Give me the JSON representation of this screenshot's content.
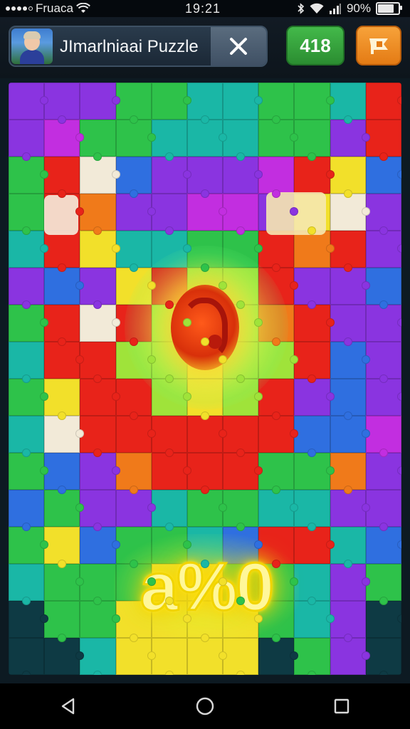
{
  "status_bar": {
    "carrier": "Fruaca",
    "time": "19:21",
    "battery": "90%",
    "battery_level": 0.9
  },
  "header": {
    "title": "JImarlniaai Puzzle",
    "score": "418",
    "close_icon": "close-icon",
    "flag_icon": "flag-icon"
  },
  "board": {
    "progress_label": "a%0",
    "center_icon": "question-orb-icon",
    "rows": 16,
    "cols": 11,
    "palette": {
      "R": "#e8231a",
      "O": "#f07a1a",
      "Y": "#f2e02a",
      "G": "#2ec24a",
      "T": "#1ab7a6",
      "B": "#2f6fe0",
      "P": "#8a34e0",
      "M": "#c22ee0",
      "D": "#0e3a44",
      "W": "#f2ead8",
      "L": "#9fe33a"
    },
    "grid": [
      "PPPGGTTGGTR",
      "PMGGTTTGGPR",
      "GRWBPPPMRYB",
      "GROPPMMPYWP",
      "TRYTTGGRORP",
      "PBPYRLLRPPB",
      "GRWRLYLORPP",
      "TRRLLYLLRBP",
      "GYRRLYLRPBP",
      "TWRRRRRRBBM",
      "GBPORRRGGOP",
      "BGPPTGGTTPP",
      "GYBGGTBRRTB",
      "TGGGYYGGTPG",
      "DGGYYYYGTPD",
      "DDTYYYYDGPD"
    ]
  },
  "nav": {
    "back_icon": "back-triangle-icon",
    "home_icon": "home-circle-icon",
    "recents_icon": "recents-square-icon"
  }
}
